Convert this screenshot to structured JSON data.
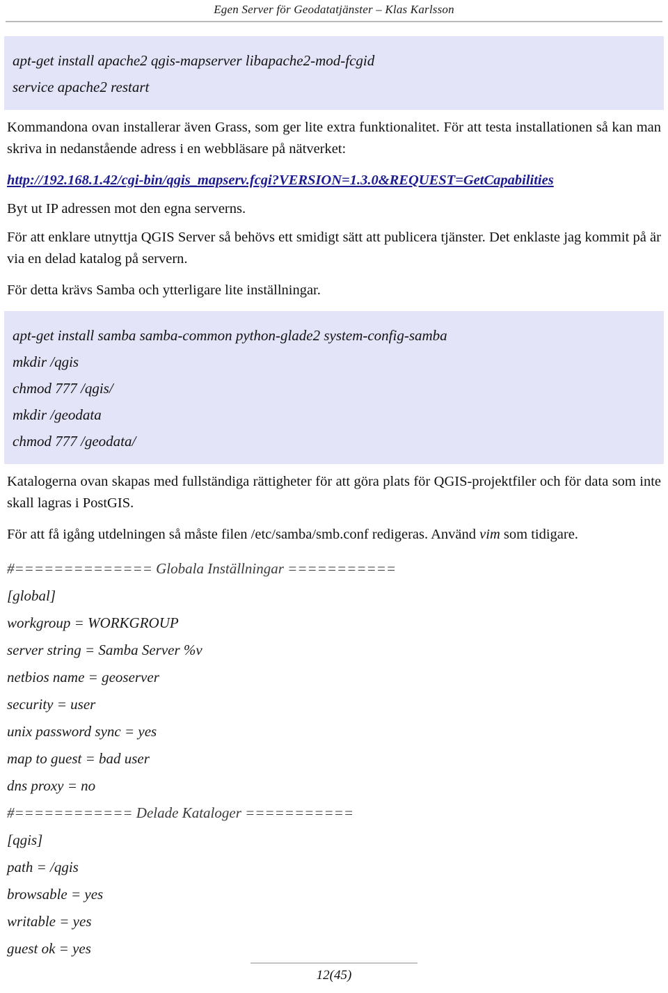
{
  "header": {
    "title": "Egen Server för Geodatatjänster – Klas Karlsson"
  },
  "code_block_apache": {
    "lines": [
      "apt-get install apache2 qgis-mapserver libapache2-mod-fcgid",
      "service apache2 restart"
    ]
  },
  "paragraphs": {
    "grass_intro": "Kommandona ovan installerar även Grass, som ger lite extra funktionalitet. För att testa installationen så kan man skriva in nedanstående adress i en webbläsare på nätverket:",
    "url": "http://192.168.1.42/cgi-bin/qgis_mapserv.fcgi?VERSION=1.3.0&REQUEST=GetCapabilities",
    "swap_ip": "Byt ut IP adressen mot den egna serverns.",
    "qgis_server_share": "För att enklare utnyttja QGIS Server så behövs ett smidigt sätt att publicera tjänster. Det enklaste jag kommit på är via en delad katalog på servern.",
    "samba_needed": "För detta krävs Samba och ytterligare lite inställningar.",
    "catalogs_created": "Katalogerna ovan skapas med fullständiga rättigheter för att göra plats för QGIS-projektfiler och för data som inte skall lagras i PostGIS.",
    "edit_smbconf_part1": "För att få igång utdelningen så måste filen /etc/samba/smb.conf redigeras. Använd ",
    "edit_smbconf_emphasis": "vim",
    "edit_smbconf_part2": " som tidigare."
  },
  "code_block_samba": {
    "lines": [
      "apt-get install samba samba-common python-glade2 system-config-samba",
      "mkdir /qgis",
      "chmod 777 /qgis/",
      "mkdir /geodata",
      "chmod 777 /geodata/"
    ]
  },
  "smb_conf": {
    "lines": [
      "#============== Globala Inställningar ===========",
      "[global]",
      "workgroup = WORKGROUP",
      "server string = Samba Server %v",
      "netbios name = geoserver",
      "security = user",
      "unix password sync = yes",
      "map to guest = bad user",
      "dns proxy = no",
      "#============ Delade Kataloger ===========",
      "[qgis]",
      "path = /qgis",
      "browsable = yes",
      "writable = yes",
      "guest ok = yes"
    ]
  },
  "footer": {
    "page_number": "12(45)"
  },
  "colors": {
    "code_background": "#e4e4f8",
    "link": "#1c1c8f",
    "rule": "#b9b9b9",
    "text": "#111111"
  }
}
